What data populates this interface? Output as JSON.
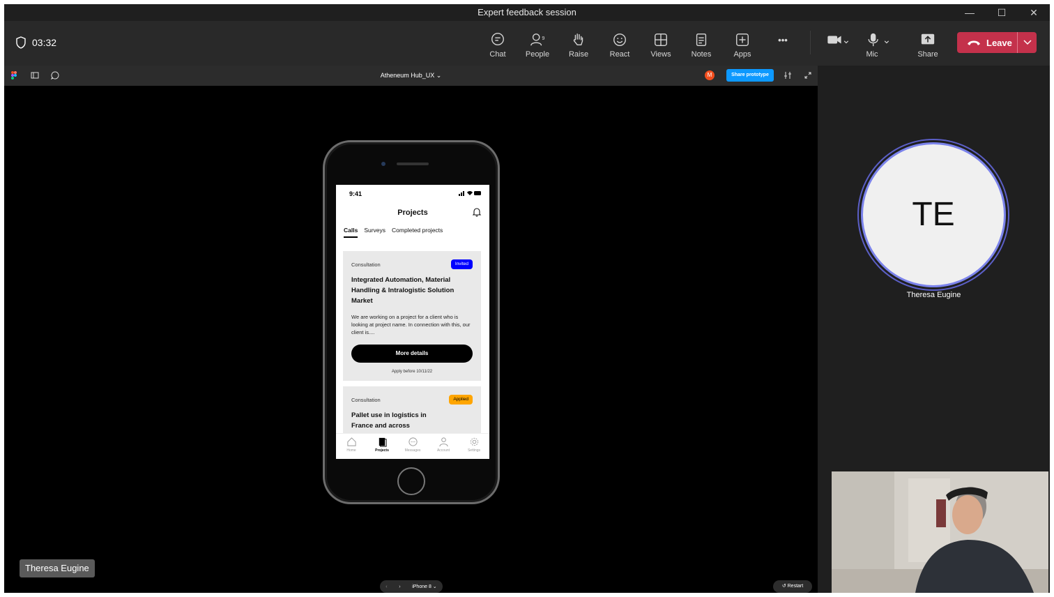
{
  "window": {
    "title": "Expert feedback session",
    "min": "—",
    "max": "☐",
    "close": "✕"
  },
  "toolbar": {
    "timer": "03:32",
    "chat": "Chat",
    "people": "People",
    "people_count": "9",
    "raise": "Raise",
    "react": "React",
    "views": "Views",
    "notes": "Notes",
    "apps": "Apps",
    "more": "•••",
    "mic": "Mic",
    "share": "Share",
    "leave": "Leave"
  },
  "figma": {
    "file_title": "Atheneum Hub_UX ⌄",
    "avatar_initial": "M",
    "share_label": "Share prototype",
    "device": "iPhone 8 ⌄",
    "restart": "Restart"
  },
  "app": {
    "time": "9:41",
    "title": "Projects",
    "tabs": [
      "Calls",
      "Surveys",
      "Completed projects"
    ],
    "cards": [
      {
        "type": "Consultation",
        "badge": "Invited",
        "title": "Integrated Automation, Material Handling & Intralogistic Solution Market",
        "desc": "We are working on a project for a client who is looking at project name. In connection with this, our client is....",
        "button": "More details",
        "apply": "Apply before 10/11/22"
      },
      {
        "type": "Consultation",
        "badge": "Applied",
        "title": "Pallet use in logistics in France and across"
      }
    ],
    "nav": [
      "Home",
      "Projects",
      "Messages",
      "Account",
      "Settings"
    ]
  },
  "participant": {
    "initials": "TE",
    "name": "Theresa Eugine"
  },
  "presenter_tag": "Theresa Eugine",
  "colors": {
    "leave": "#c4314b",
    "ring": "#7b83eb",
    "invited": "#0000ff",
    "applied": "#ffa500",
    "share": "#0d99ff"
  }
}
